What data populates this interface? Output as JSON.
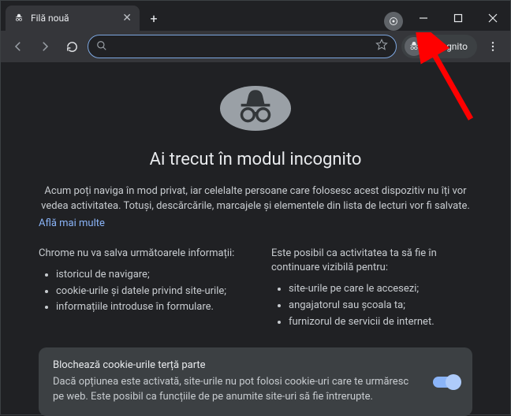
{
  "tab": {
    "title": "Filă nouă"
  },
  "toolbar": {
    "incognito_label": "Incognito",
    "search_placeholder": ""
  },
  "page": {
    "heading": "Ai trecut în modul incognito",
    "intro": "Acum poți naviga în mod privat, iar celelalte persoane care folosesc acest dispozitiv nu îți vor vedea activitatea. Totuși, descărcările, marcajele și elementele din lista de lecturi vor fi salvate.",
    "learn_more": "Află mai multe",
    "left": {
      "head": "Chrome nu va salva următoarele informații:",
      "items": [
        "istoricul de navigare;",
        "cookie-urile și datele privind site-urile;",
        "informațiile introduse în formulare."
      ]
    },
    "right": {
      "head": "Este posibil ca activitatea ta să fie în continuare vizibilă pentru:",
      "items": [
        "site-urile pe care le accesezi;",
        "angajatorul sau școala ta;",
        "furnizorul de servicii de internet."
      ]
    },
    "cookie": {
      "title": "Blochează cookie-urile terță parte",
      "body": "Dacă opțiunea este activată, site-urile nu pot folosi cookie-uri care te urmăresc pe web. Este posibil ca funcțiile de pe anumite site-uri să fie întrerupte."
    }
  }
}
